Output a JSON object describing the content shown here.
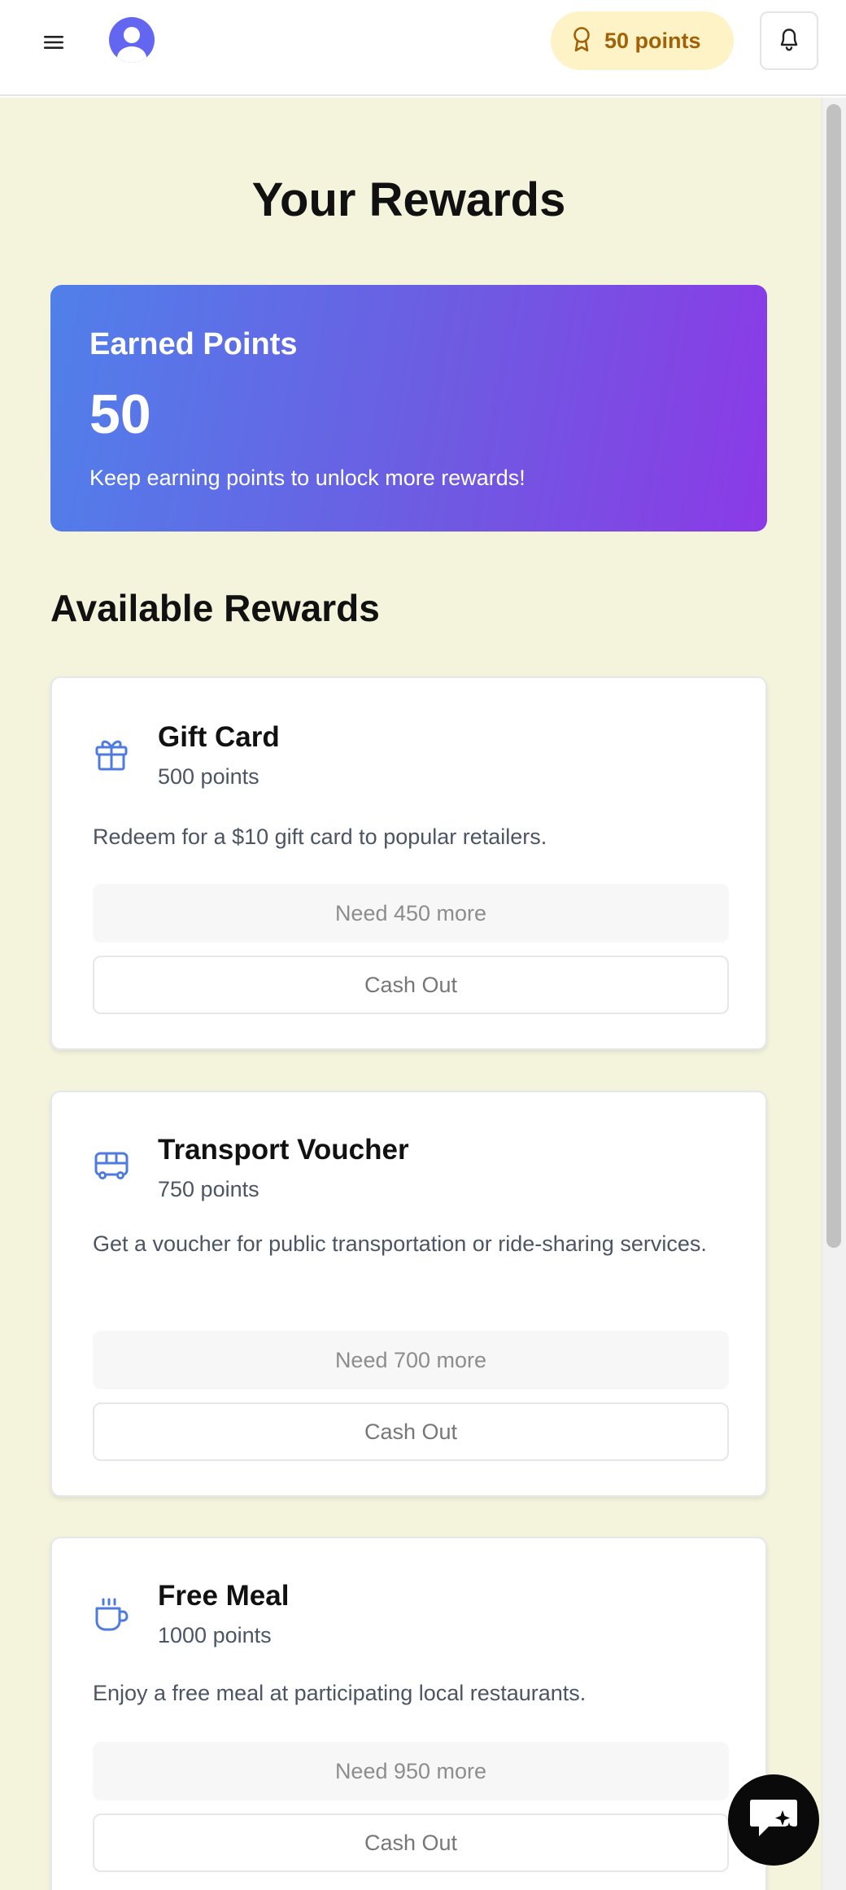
{
  "header": {
    "menu_icon": "hamburger-menu-icon",
    "avatar_icon": "user-avatar-icon",
    "points_badge": {
      "icon": "award-ribbon-icon",
      "label": "50 points"
    },
    "notification_icon": "bell-icon"
  },
  "page": {
    "title": "Your Rewards",
    "background_color": "#f4f4dd"
  },
  "earned_points": {
    "label": "Earned Points",
    "value": "50",
    "subtitle": "Keep earning points to unlock more rewards!",
    "gradient_colors": [
      "#5080ea",
      "#8b3ae6"
    ]
  },
  "available_rewards": {
    "title": "Available Rewards",
    "items": [
      {
        "icon": "gift-icon",
        "name": "Gift Card",
        "cost": "500 points",
        "description": "Redeem for a $10 gift card to popular retailers.",
        "need_label": "Need 450 more",
        "cash_out_label": "Cash Out"
      },
      {
        "icon": "bus-icon",
        "name": "Transport Voucher",
        "cost": "750 points",
        "description": "Get a voucher for public transportation or ride-sharing services.",
        "need_label": "Need 700 more",
        "cash_out_label": "Cash Out"
      },
      {
        "icon": "coffee-cup-icon",
        "name": "Free Meal",
        "cost": "1000 points",
        "description": "Enjoy a free meal at participating local restaurants.",
        "need_label": "Need 950 more",
        "cash_out_label": "Cash Out"
      }
    ]
  },
  "chat_button": {
    "icon": "chat-sparkle-icon"
  },
  "colors": {
    "accent_blue": "#4f7be0",
    "badge_yellow": "#fef3c7",
    "badge_text": "#a16207"
  }
}
